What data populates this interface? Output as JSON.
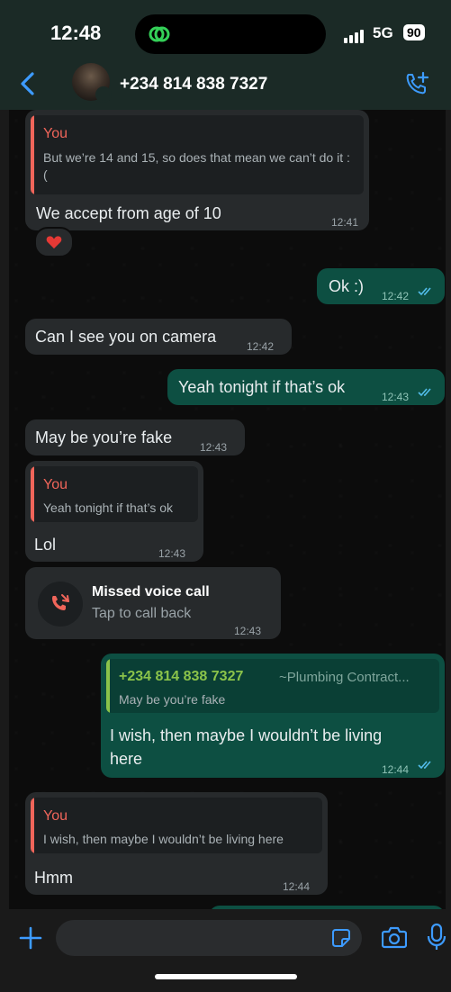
{
  "status_bar": {
    "time": "12:48",
    "network": "5G",
    "battery": "90"
  },
  "header": {
    "contact_name": "+234 814 838 7327"
  },
  "messages": {
    "m1": {
      "quote_author": "You",
      "quote_text": "But we’re 14 and 15, so does that mean we can’t do it :(",
      "text": "We accept from age of 10",
      "time": "12:41",
      "reaction": "❤️"
    },
    "m2": {
      "text": "Ok :)",
      "time": "12:42"
    },
    "m3": {
      "text": "Can I see you on camera",
      "time": "12:42"
    },
    "m4": {
      "text": "Yeah tonight if that’s ok",
      "time": "12:43"
    },
    "m5": {
      "text": "May be you’re fake",
      "time": "12:43"
    },
    "m6": {
      "quote_author": "You",
      "quote_text": "Yeah tonight if that’s ok",
      "text": "Lol",
      "time": "12:43"
    },
    "m7": {
      "title": "Missed voice call",
      "subtitle": "Tap to call back",
      "time": "12:43"
    },
    "m8": {
      "quote_author": "+234 814 838 7327",
      "quote_author_extra": "~Plumbing Contract...",
      "quote_text": "May be you’re fake",
      "text_line1": "I wish, then maybe I wouldn’t be living",
      "text_line2": "here",
      "time": "12:44"
    },
    "m9": {
      "quote_author": "You",
      "quote_text": "I wish, then maybe I wouldn’t be living here",
      "text": "Hmm",
      "time": "12:44"
    }
  },
  "colors": {
    "accent_blue": "#3d9bff",
    "quote_you": "#f0655a",
    "quote_contact": "#8bc34a",
    "bubble_out": "#0d4f42",
    "bubble_in": "#272a2c"
  }
}
